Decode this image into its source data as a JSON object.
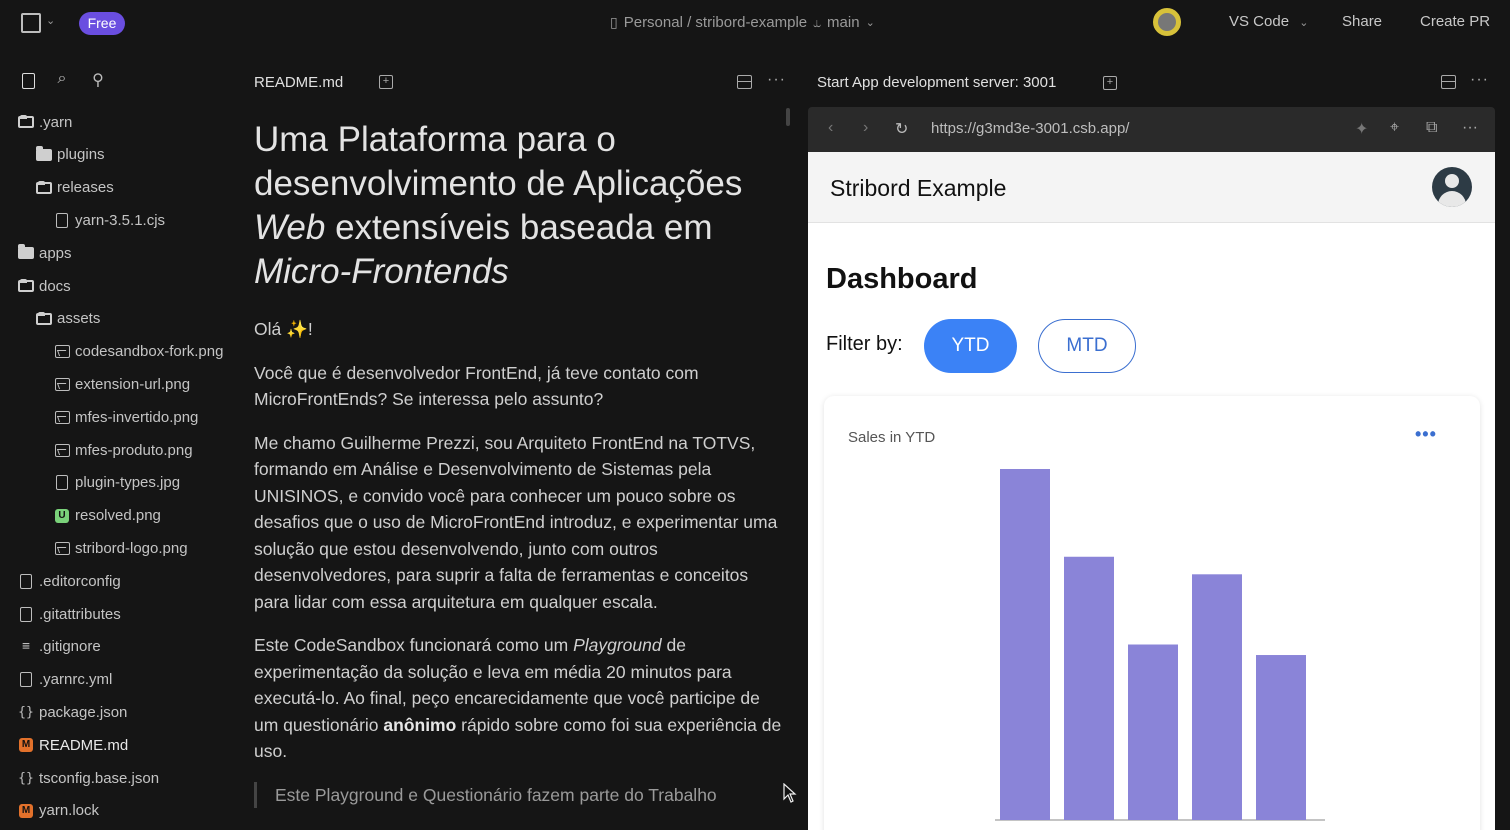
{
  "topbar": {
    "badge": "Free",
    "project": "Personal / stribord-example",
    "branch": "main",
    "editor_menu": "VS Code",
    "share": "Share",
    "create_pr": "Create PR"
  },
  "sidebar": {
    "tree": [
      {
        "label": ".yarn",
        "icon": "folder-open-icon"
      },
      {
        "label": "plugins",
        "icon": "folder-icon"
      },
      {
        "label": "releases",
        "icon": "folder-open-icon"
      },
      {
        "label": "yarn-3.5.1.cjs",
        "icon": "file-icon"
      },
      {
        "label": "apps",
        "icon": "folder-icon"
      },
      {
        "label": "docs",
        "icon": "folder-open-icon"
      },
      {
        "label": "assets",
        "icon": "folder-open-icon"
      },
      {
        "label": "codesandbox-fork.png",
        "icon": "image-icon"
      },
      {
        "label": "extension-url.png",
        "icon": "image-icon"
      },
      {
        "label": "mfes-invertido.png",
        "icon": "image-icon"
      },
      {
        "label": "mfes-produto.png",
        "icon": "image-icon"
      },
      {
        "label": "plugin-types.jpg",
        "icon": "file-icon"
      },
      {
        "label": "resolved.png",
        "icon": "u-badge-icon"
      },
      {
        "label": "stribord-logo.png",
        "icon": "image-icon"
      },
      {
        "label": ".editorconfig",
        "icon": "file-icon"
      },
      {
        "label": ".gitattributes",
        "icon": "file-icon"
      },
      {
        "label": ".gitignore",
        "icon": "lines-icon"
      },
      {
        "label": ".yarnrc.yml",
        "icon": "file-icon"
      },
      {
        "label": "package.json",
        "icon": "braces-icon"
      },
      {
        "label": "README.md",
        "icon": "markdown-icon"
      },
      {
        "label": "tsconfig.base.json",
        "icon": "braces-icon"
      },
      {
        "label": "yarn.lock",
        "icon": "markdown-icon"
      }
    ]
  },
  "editor": {
    "tab": "README.md",
    "h1_a": "Uma Plataforma para o desenvolvimento de Aplicações ",
    "h1_b": "Web",
    "h1_c": " extensíveis baseada em ",
    "h1_d": "Micro-Frontends",
    "p1": "Olá ✨!",
    "p2": "Você que é desenvolvedor FrontEnd, já teve contato com MicroFrontEnds? Se interessa pelo assunto?",
    "p3": "Me chamo Guilherme Prezzi, sou Arquiteto FrontEnd na TOTVS, formando em Análise e Desenvolvimento de Sistemas pela UNISINOS, e convido você para conhecer um pouco sobre os desafios que o uso de MicroFrontEnd introduz, e experimentar uma solução que estou desenvolvendo, junto com outros desenvolvedores, para suprir a falta de ferramentas e conceitos para lidar com essa arquitetura em qualquer escala.",
    "p4_a": "Este CodeSandbox funcionará como um ",
    "p4_b": "Playground",
    "p4_c": " de experimentação da solução e leva em média 20 minutos para executá-lo. Ao final, peço encarecidamente que você participe de um questionário ",
    "p4_d": "anônimo",
    "p4_e": " rápido sobre como foi sua experiência de uso.",
    "quote": "Este Playground e Questionário fazem parte do Trabalho"
  },
  "preview": {
    "tab": "Start App development server: 3001",
    "url": "https://g3md3e-3001.csb.app/",
    "app_title": "Stribord Example",
    "dashboard": "Dashboard",
    "filter_label": "Filter by:",
    "btn_ytd": "YTD",
    "btn_mtd": "MTD",
    "card_title": "Sales in YTD"
  },
  "colors": {
    "accent": "#3b82f6",
    "badge": "#6a4ee0",
    "bar": "#8a84d8"
  },
  "chart_data": {
    "type": "bar",
    "title": "Sales in YTD",
    "categories": [
      "",
      "",
      "",
      "",
      ""
    ],
    "values": [
      100,
      75,
      50,
      70,
      47
    ],
    "ylim": [
      0,
      100
    ],
    "grid": false
  }
}
